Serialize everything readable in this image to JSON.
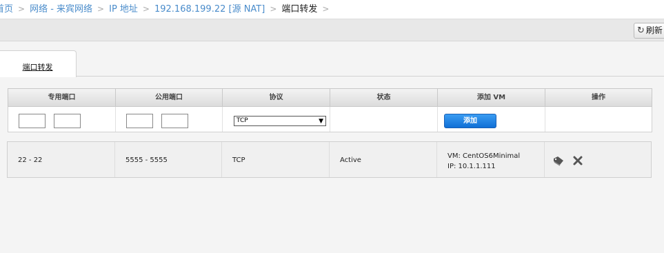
{
  "breadcrumb": {
    "items": [
      "首页",
      "网络 - 来宾网络",
      "IP 地址",
      "192.168.199.22 [源 NAT]"
    ],
    "current": "端口转发",
    "separator": ">"
  },
  "toolbar": {
    "refresh_label": "刷新",
    "refresh_icon": "refresh-icon"
  },
  "tabs": [
    {
      "label": "端口转发"
    }
  ],
  "table": {
    "columns": [
      "专用端口",
      "公用端口",
      "协议",
      "状态",
      "添加 VM",
      "操作"
    ],
    "add_row": {
      "private_port_start": "",
      "private_port_end": "",
      "public_port_start": "",
      "public_port_end": "",
      "protocol": "TCP",
      "add_button_label": "添加"
    },
    "rows": [
      {
        "private_port": "22 - 22",
        "public_port": "5555 - 5555",
        "protocol": "TCP",
        "state": "Active",
        "vm_label": "VM: CentOS6Minimal",
        "ip_label": "IP: 10.1.1.111",
        "actions": [
          "tag-icon",
          "delete-icon"
        ]
      }
    ]
  }
}
